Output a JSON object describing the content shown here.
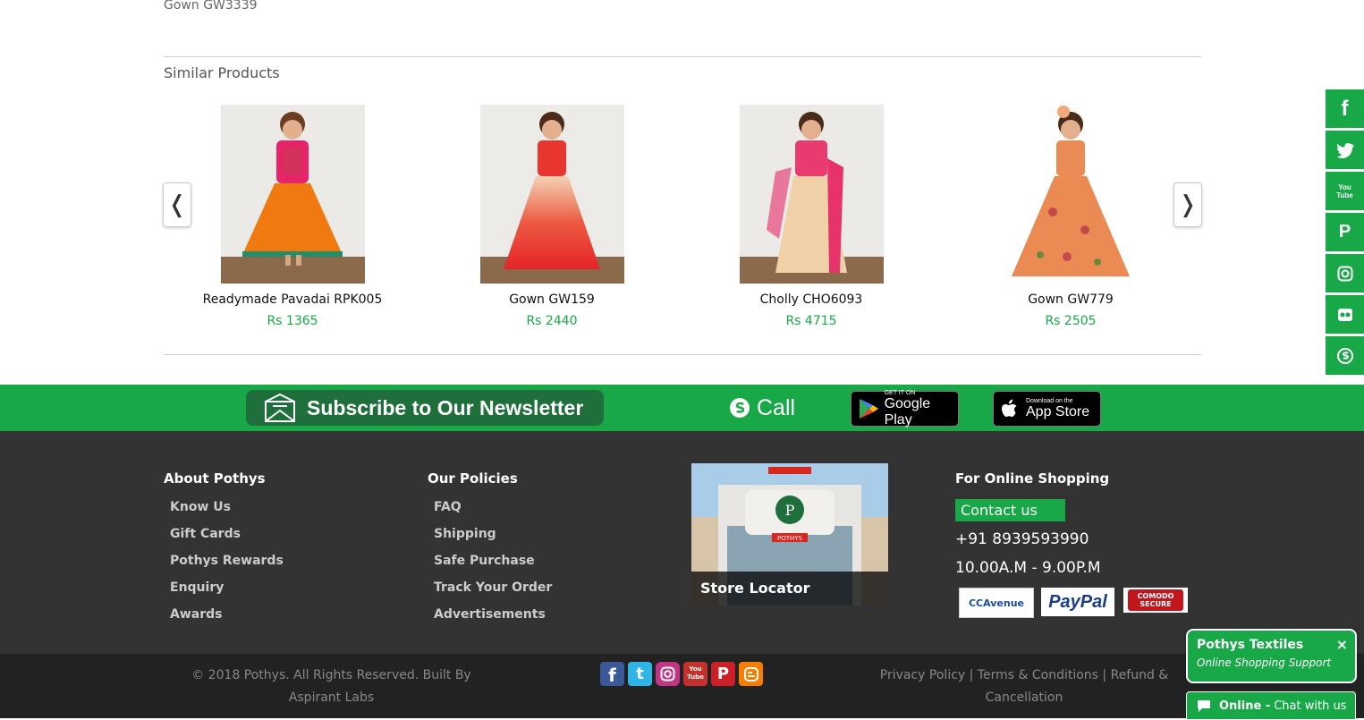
{
  "page": {
    "product_title": "Gown GW3339",
    "similar_title": "Similar Products"
  },
  "carousel": {
    "prev_symbol": "❬",
    "next_symbol": "❭",
    "products": [
      {
        "name": "Readymade Pavadai RPK005",
        "price": "Rs 1365"
      },
      {
        "name": "Gown GW159",
        "price": "Rs 2440"
      },
      {
        "name": "Cholly CHO6093",
        "price": "Rs 4715"
      },
      {
        "name": "Gown GW779",
        "price": "Rs 2505"
      }
    ]
  },
  "social_sidebar": {
    "icons": [
      "facebook-icon",
      "twitter-icon",
      "youtube-icon",
      "pinterest-icon",
      "instagram-icon",
      "flickr-icon",
      "skype-icon"
    ],
    "facebook": "f",
    "youtube": "You Tube",
    "pinterest": "P"
  },
  "band": {
    "newsletter_label": "Subscribe to Our Newsletter",
    "call_label": "Call",
    "google_play_small": "GET IT ON",
    "google_play_big": "Google Play",
    "app_store_small": "Download on the",
    "app_store_big": "App Store"
  },
  "footer": {
    "about": {
      "title": "About Pothys",
      "links": [
        "Know Us",
        "Gift Cards",
        "Pothys Rewards",
        "Enquiry",
        "Awards"
      ]
    },
    "policies": {
      "title": "Our Policies",
      "links": [
        "FAQ",
        "Shipping",
        "Safe Purchase",
        "Track Your Order",
        "Advertisements"
      ]
    },
    "store": {
      "label": "Store Locator",
      "sign": "POTHYS"
    },
    "online": {
      "title": "For Online Shopping",
      "contact_button": "Contact us",
      "phone": "+91 8939593990",
      "hours": "10.00A.M - 9.00P.M"
    },
    "payments": {
      "ccavenue": "CCAvenue",
      "paypal": "PayPal",
      "comodo": "COMODO SECURE"
    }
  },
  "bottom": {
    "copyright": "© 2018 Pothys. All Rights Reserved. Built By Aspirant Labs",
    "policies_links": "Privacy Policy | Terms & Conditions | Refund & Cancellation"
  },
  "chat": {
    "company": "Pothys Textiles",
    "subtitle": "Online Shopping Support",
    "close": "×",
    "status": "Online -",
    "action": "Chat with us"
  },
  "colors": {
    "accent_green": "#18a848",
    "footer_dark": "#333333",
    "bottom_dark": "#222222"
  }
}
